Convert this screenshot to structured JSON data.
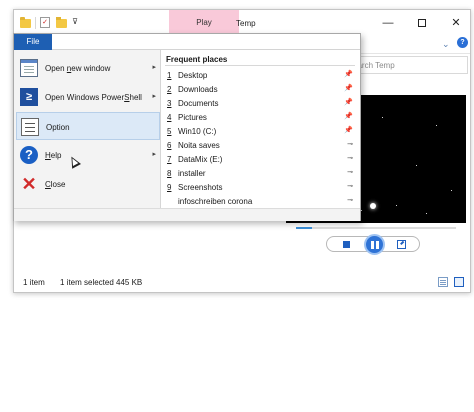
{
  "titlebar": {
    "context_tab": "Play",
    "title": "Temp",
    "minimize_glyph": "—",
    "maximize_glyph": "",
    "close_glyph": "✕",
    "properties_glyph": "✓",
    "qat_dropdown_glyph": "⊽"
  },
  "ribbon": {
    "expand_glyph": "⌄",
    "help_glyph": "?"
  },
  "search": {
    "placeholder": "Search Temp",
    "visible_text": "earch Temp"
  },
  "media": {
    "progress_fraction": 0.1,
    "stop_label": "Stop",
    "play_state": "playing"
  },
  "status": {
    "item_count": "1 item",
    "selected": "1 item selected",
    "size": "445 KB"
  },
  "file_menu": {
    "tab_label": "File",
    "items": [
      {
        "pre": "Open ",
        "key": "n",
        "post": "ew window",
        "has_submenu": true,
        "icon": "new-window-icon"
      },
      {
        "pre": "Open Windows Power",
        "key": "S",
        "post": "hell",
        "has_submenu": true,
        "icon": "powershell-icon"
      },
      {
        "pre": "Optio",
        "key": "",
        "post": "n",
        "has_submenu": false,
        "icon": "options-icon"
      },
      {
        "pre": "",
        "key": "H",
        "post": "elp",
        "has_submenu": true,
        "icon": "help-icon"
      },
      {
        "pre": "",
        "key": "C",
        "post": "lose",
        "has_submenu": false,
        "icon": "close-icon"
      }
    ],
    "arrow_glyph": "▸",
    "powershell_glyph": "≥",
    "help_glyph": "?",
    "close_glyph": "✕"
  },
  "frequent_places": {
    "title": "Frequent places",
    "pinned_glyph": "📌",
    "unpinned_glyph": "⊸",
    "items": [
      {
        "num": "1",
        "label": "Desktop",
        "pinned": true
      },
      {
        "num": "2",
        "label": "Downloads",
        "pinned": true
      },
      {
        "num": "3",
        "label": "Documents",
        "pinned": true
      },
      {
        "num": "4",
        "label": "Pictures",
        "pinned": true
      },
      {
        "num": "5",
        "label": "Win10 (C:)",
        "pinned": true
      },
      {
        "num": "6",
        "label": "Noita saves",
        "pinned": false
      },
      {
        "num": "7",
        "label": "DataMix (E:)",
        "pinned": false
      },
      {
        "num": "8",
        "label": "installer",
        "pinned": false
      },
      {
        "num": "9",
        "label": "Screenshots",
        "pinned": false
      },
      {
        "num": "",
        "label": "infoschreiben corona",
        "pinned": false
      }
    ]
  }
}
